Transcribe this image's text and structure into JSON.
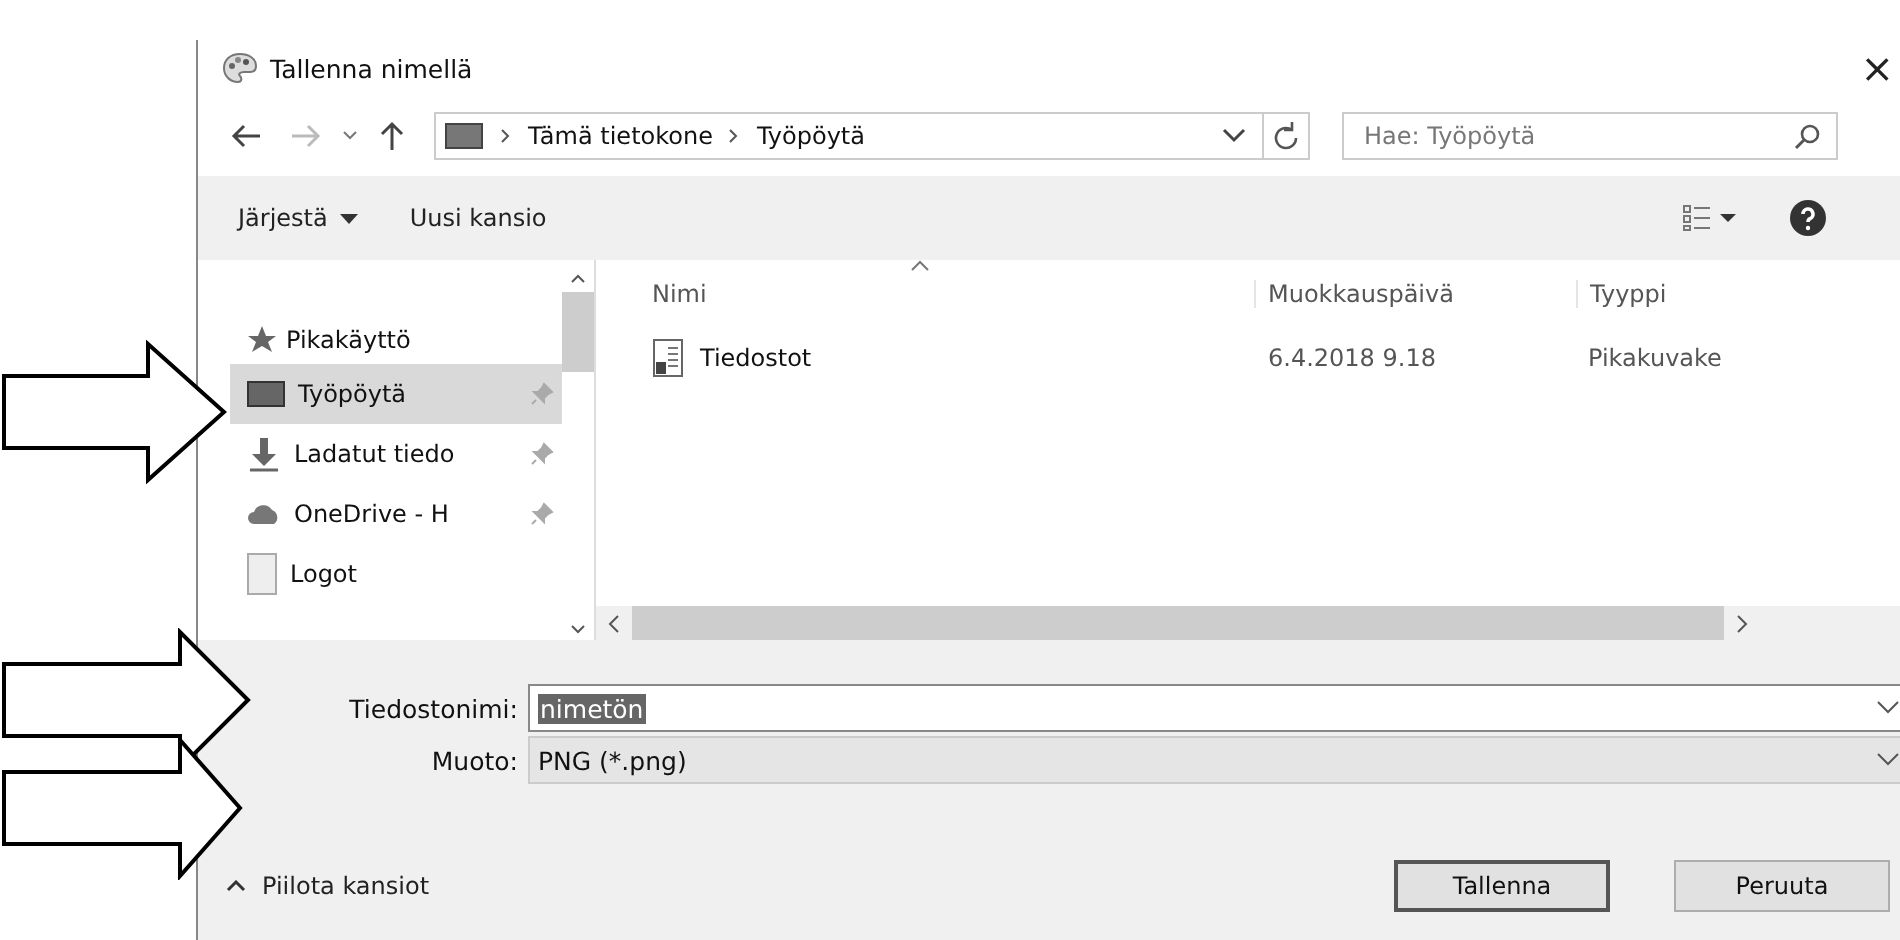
{
  "window": {
    "title": "Tallenna nimellä",
    "close": "×"
  },
  "address": {
    "crumbs": [
      "Tämä tietokone",
      "Työpöytä"
    ],
    "search_placeholder": "Hae: Työpöytä"
  },
  "toolbar": {
    "organize": "Järjestä",
    "new_folder": "Uusi kansio"
  },
  "sidebar": {
    "heading": "Pikakäyttö",
    "items": [
      {
        "label": "Työpöytä",
        "kind": "desktop",
        "pinned": true,
        "selected": true
      },
      {
        "label": "Ladatut tiedo",
        "kind": "download",
        "pinned": true,
        "selected": false
      },
      {
        "label": "OneDrive - H",
        "kind": "cloud",
        "pinned": true,
        "selected": false
      },
      {
        "label": "Logot",
        "kind": "folder",
        "pinned": false,
        "selected": false
      }
    ]
  },
  "table": {
    "columns": [
      "Nimi",
      "Muokkauspäivä",
      "Tyyppi"
    ],
    "rows": [
      {
        "name": "Tiedostot",
        "date": "6.4.2018 9.18",
        "type": "Pikakuvake"
      }
    ]
  },
  "form": {
    "filename_label": "Tiedostonimi:",
    "filename": "nimetön",
    "format_label": "Muoto:",
    "format": "PNG (*.png)"
  },
  "footer": {
    "hide_folders": "Piilota kansiot",
    "buttons": [
      "Tallenna",
      "Peruuta"
    ]
  }
}
